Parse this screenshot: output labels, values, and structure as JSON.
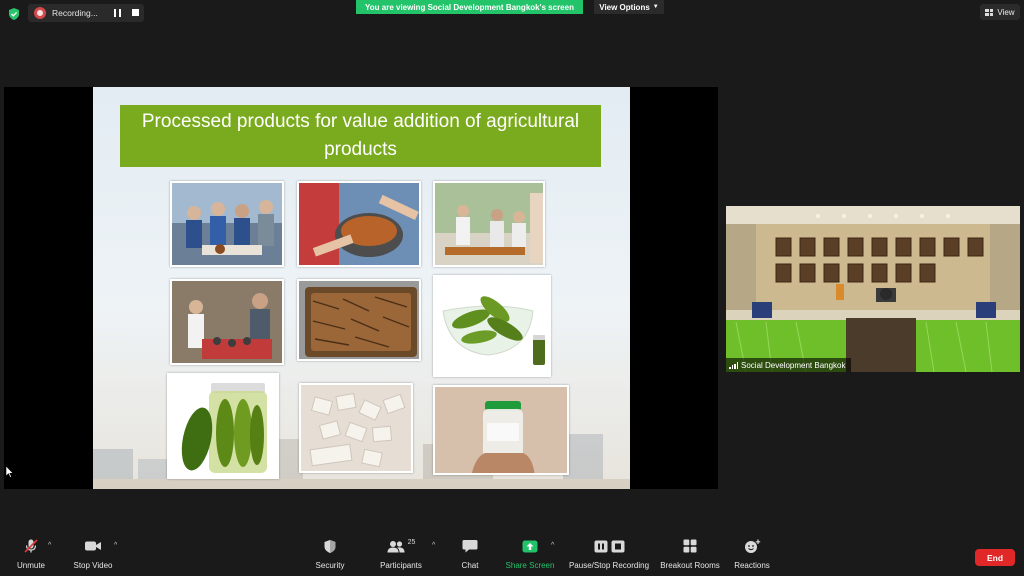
{
  "recording": {
    "label": "Recording..."
  },
  "banner": {
    "viewing_text": "You are viewing Social Development Bangkok's screen",
    "view_options_label": "View Options",
    "view_label": "View"
  },
  "slide": {
    "title": "Processed products for value addition of agricultural products"
  },
  "participant": {
    "name": "Social Development Bangkok"
  },
  "toolbar": {
    "unmute": "Unmute",
    "stop_video": "Stop Video",
    "security": "Security",
    "participants": "Participants",
    "participants_count": "25",
    "chat": "Chat",
    "share_screen": "Share Screen",
    "recording": "Pause/Stop Recording",
    "breakout": "Breakout Rooms",
    "reactions": "Reactions",
    "end": "End"
  },
  "colors": {
    "accent_green": "#23c36a",
    "slide_title_bg": "#7aab1e",
    "end_red": "#e02828"
  }
}
